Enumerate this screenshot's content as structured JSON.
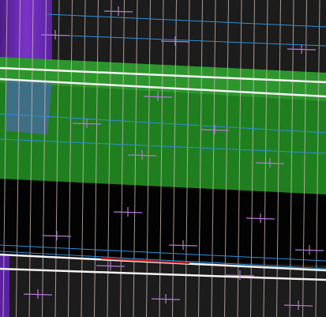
{
  "viewport": {
    "title": "",
    "colors": {
      "background": "#1c1c1c",
      "green_band": "#1f7a1f",
      "green_band_light": "#3aa83a",
      "black_band": "#020202",
      "purple_strip": "#6a2bb0",
      "blue_panel": "#4a6aa0",
      "grid_line": "#c9b8b0",
      "blue_line": "#2a8cd8",
      "white_line": "#f2f2f2",
      "red_line": "#d02020",
      "marker": "#b070d0"
    },
    "layers": [
      {
        "name": "purple-strip-layer"
      },
      {
        "name": "green-band-layer"
      },
      {
        "name": "black-band-layer"
      },
      {
        "name": "vertical-grid-layer"
      },
      {
        "name": "horizontal-line-layer"
      },
      {
        "name": "marker-layer"
      }
    ]
  }
}
